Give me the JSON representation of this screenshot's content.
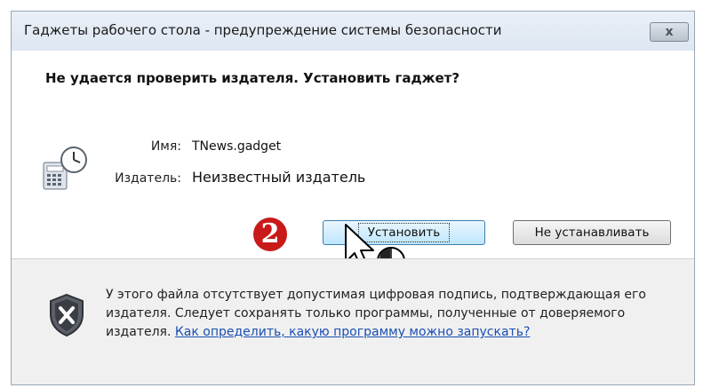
{
  "window": {
    "title": "Гаджеты рабочего стола - предупреждение системы безопасности",
    "close_label": "x"
  },
  "dialog": {
    "question": "Не удается проверить издателя. Установить гаджет?",
    "name_label": "Имя:",
    "name_value": "TNews.gadget",
    "publisher_label": "Издатель:",
    "publisher_value": "Неизвестный издатель",
    "step_badge": "2"
  },
  "buttons": {
    "install_label": "Установить",
    "dont_install_label": "Не устанавливать"
  },
  "footer": {
    "warning_text": "У этого файла отсутствует допустимая цифровая подпись, подтверждающая его издателя. Следует сохранять только программы, полученные от доверяемого издателя.",
    "help_link": "Как определить, какую программу можно запускать?"
  },
  "colors": {
    "badge": "#c91a1a",
    "link": "#1a4fb3"
  }
}
